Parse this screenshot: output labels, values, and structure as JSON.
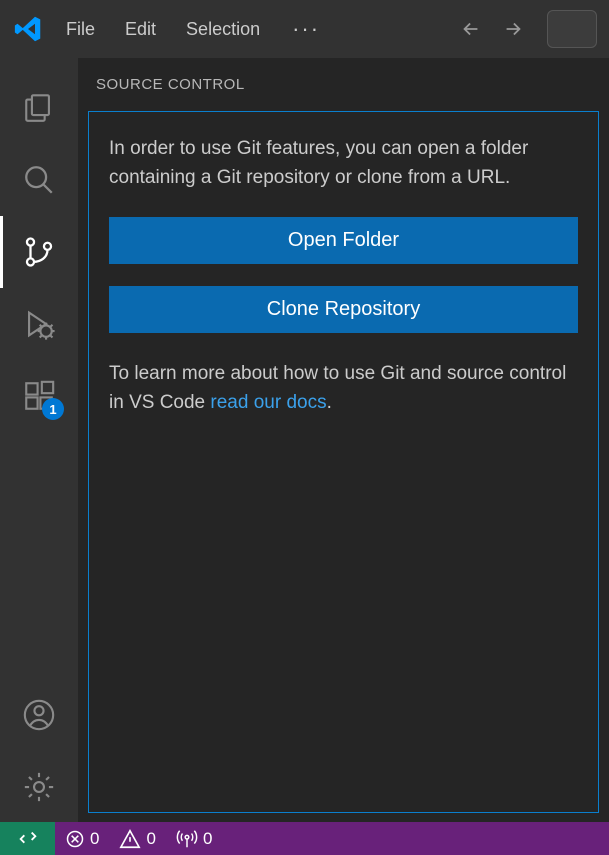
{
  "titlebar": {
    "menu": {
      "file": "File",
      "edit": "Edit",
      "selection": "Selection"
    }
  },
  "activitybar": {
    "extensions_badge": "1"
  },
  "sidebar": {
    "title": "SOURCE CONTROL",
    "intro": "In order to use Git features, you can open a folder containing a Git repository or clone from a URL.",
    "open_folder_label": "Open Folder",
    "clone_repo_label": "Clone Repository",
    "learn_prefix": "To learn more about how to use Git and source control in VS Code ",
    "learn_link": "read our docs",
    "learn_suffix": "."
  },
  "statusbar": {
    "errors": "0",
    "warnings": "0",
    "ports": "0"
  }
}
